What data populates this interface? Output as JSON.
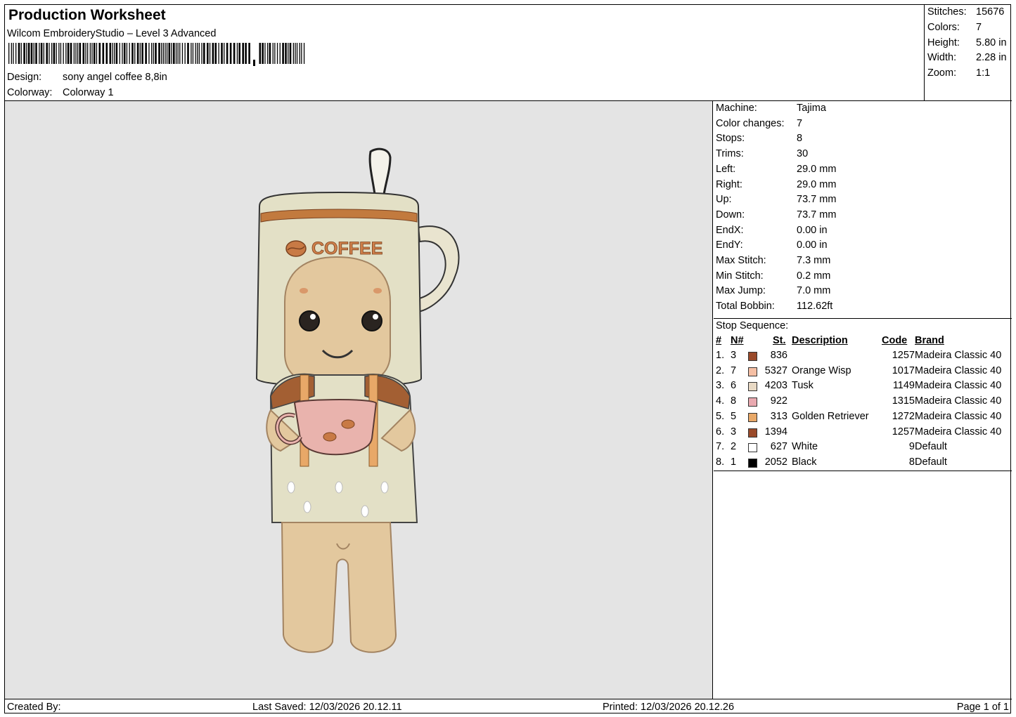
{
  "header": {
    "title": "Production Worksheet",
    "software": "Wilcom EmbroideryStudio – Level 3 Advanced",
    "design_label": "Design:",
    "design_value": "sony angel coffee 8,8in",
    "colorway_label": "Colorway:",
    "colorway_value": "Colorway 1"
  },
  "stats": [
    {
      "label": "Stitches:",
      "value": "15676"
    },
    {
      "label": "Colors:",
      "value": "7"
    },
    {
      "label": "Height:",
      "value": "5.80 in"
    },
    {
      "label": "Width:",
      "value": "2.28 in"
    },
    {
      "label": "Zoom:",
      "value": "1:1"
    }
  ],
  "machine_info": [
    {
      "label": "Machine:",
      "value": "Tajima"
    },
    {
      "label": "Color changes:",
      "value": "7"
    },
    {
      "label": "Stops:",
      "value": "8"
    },
    {
      "label": "Trims:",
      "value": "30"
    },
    {
      "label": "Left:",
      "value": "29.0 mm"
    },
    {
      "label": "Right:",
      "value": "29.0 mm"
    },
    {
      "label": "Up:",
      "value": "73.7 mm"
    },
    {
      "label": "Down:",
      "value": "73.7 mm"
    },
    {
      "label": "EndX:",
      "value": "0.00 in"
    },
    {
      "label": "EndY:",
      "value": "0.00 in"
    },
    {
      "label": "Max Stitch:",
      "value": "7.3 mm"
    },
    {
      "label": "Min Stitch:",
      "value": "0.2 mm"
    },
    {
      "label": "Max Jump:",
      "value": "7.0 mm"
    },
    {
      "label": "Total Bobbin:",
      "value": "112.62ft"
    }
  ],
  "stop_sequence": {
    "title": "Stop Sequence:",
    "headers": {
      "num": "#",
      "n": "N#",
      "st": "St.",
      "description": "Description",
      "code": "Code",
      "brand": "Brand"
    },
    "rows": [
      {
        "num": "1.",
        "n": "3",
        "color": "#9a4a2a",
        "st": "836",
        "description": "",
        "code": "1257",
        "brand": "Madeira Classic 40"
      },
      {
        "num": "2.",
        "n": "7",
        "color": "#f5bfa4",
        "st": "5327",
        "description": "Orange Wisp",
        "code": "1017",
        "brand": "Madeira Classic 40"
      },
      {
        "num": "3.",
        "n": "6",
        "color": "#e8d9c4",
        "st": "4203",
        "description": "Tusk",
        "code": "1149",
        "brand": "Madeira Classic 40"
      },
      {
        "num": "4.",
        "n": "8",
        "color": "#e9a9b0",
        "st": "922",
        "description": "",
        "code": "1315",
        "brand": "Madeira Classic 40"
      },
      {
        "num": "5.",
        "n": "5",
        "color": "#e8a868",
        "st": "313",
        "description": "Golden Retriever",
        "code": "1272",
        "brand": "Madeira Classic 40"
      },
      {
        "num": "6.",
        "n": "3",
        "color": "#9a4a2a",
        "st": "1394",
        "description": "",
        "code": "1257",
        "brand": "Madeira Classic 40"
      },
      {
        "num": "7.",
        "n": "2",
        "color": "#ffffff",
        "st": "627",
        "description": "White",
        "code": "9",
        "brand": "Default"
      },
      {
        "num": "8.",
        "n": "1",
        "color": "#000000",
        "st": "2052",
        "description": "Black",
        "code": "8",
        "brand": "Default"
      }
    ]
  },
  "design_text": "COFFEE",
  "footer": {
    "created_by": "Created By:",
    "last_saved": "Last Saved: 12/03/2026 20.12.11",
    "printed": "Printed: 12/03/2026 20.12.26",
    "page": "Page 1 of 1"
  }
}
